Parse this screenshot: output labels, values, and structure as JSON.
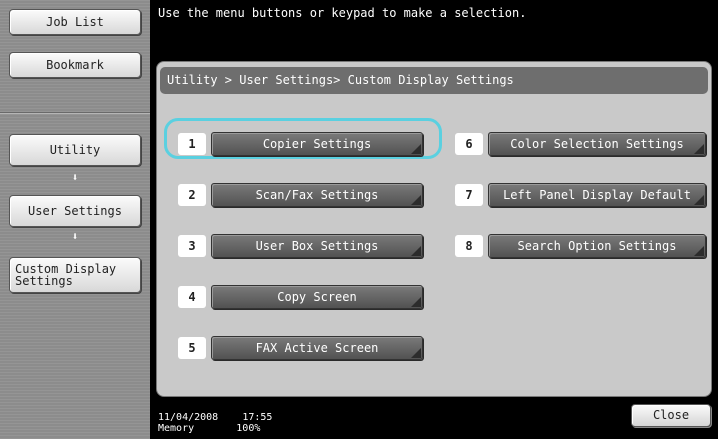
{
  "left_panel": {
    "job_list_label": "Job List",
    "bookmark_label": "Bookmark",
    "nav": [
      {
        "label": "Utility"
      },
      {
        "label": "User Settings"
      },
      {
        "label": "Custom Display\nSettings"
      }
    ],
    "arrow_glyph": "⬇"
  },
  "message": "Use the menu buttons or keypad to make a selection.",
  "breadcrumb": "Utility > User Settings> Custom Display Settings",
  "menu": {
    "left": [
      {
        "num": "1",
        "label": "Copier Settings"
      },
      {
        "num": "2",
        "label": "Scan/Fax Settings"
      },
      {
        "num": "3",
        "label": "User Box Settings"
      },
      {
        "num": "4",
        "label": "Copy Screen"
      },
      {
        "num": "5",
        "label": "FAX Active Screen"
      }
    ],
    "right": [
      {
        "num": "6",
        "label": "Color Selection Settings"
      },
      {
        "num": "7",
        "label": "Left Panel Display Default"
      },
      {
        "num": "8",
        "label": "Search Option Settings"
      }
    ],
    "selected": "1"
  },
  "footer": {
    "date": "11/04/2008",
    "time": "17:55",
    "memory_label": "Memory",
    "memory_value": "100%",
    "close_label": "Close"
  },
  "colors": {
    "highlight": "#5ad0e0",
    "menu_button": "#636363",
    "panel_bg": "#c9c9c9"
  }
}
